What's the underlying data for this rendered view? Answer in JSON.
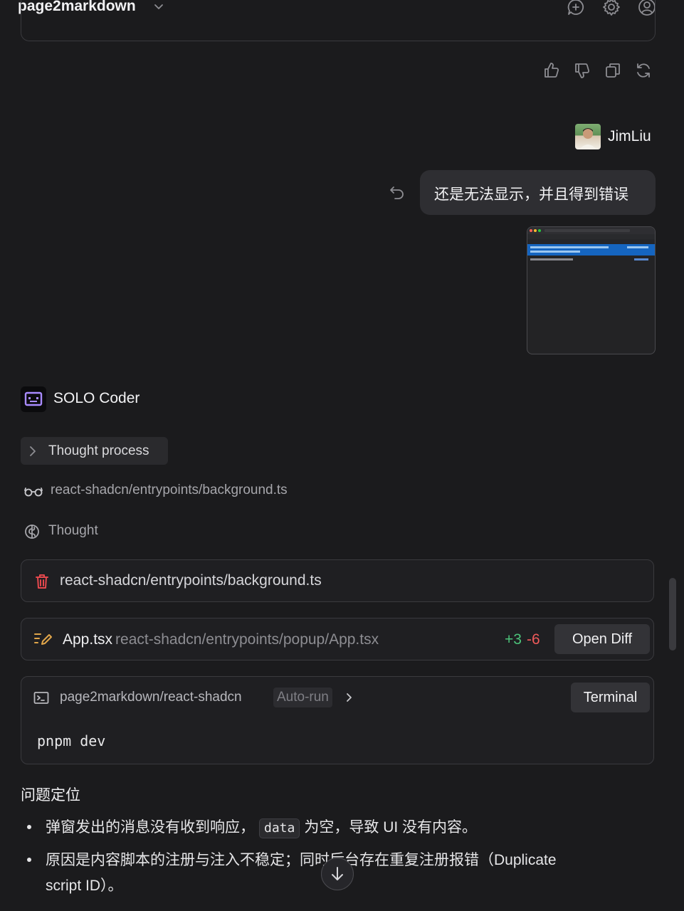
{
  "header": {
    "title": "page2markdown",
    "icons": [
      "new-chat-icon",
      "gear-icon",
      "account-icon"
    ]
  },
  "feedback": {
    "icons": [
      "thumbs-up-icon",
      "thumbs-down-icon",
      "copy-icon",
      "regenerate-icon"
    ]
  },
  "user_message": {
    "name": "JimLiu",
    "text": "还是无法显示，并且得到错误"
  },
  "assistant": {
    "name": "SOLO Coder",
    "thought_process_label": "Thought process",
    "read_file_path": "react-shadcn/entrypoints/background.ts",
    "thought_label": "Thought",
    "deleted_file": {
      "path": "react-shadcn/entrypoints/background.ts"
    },
    "diff": {
      "file": "App.tsx",
      "path": "react-shadcn/entrypoints/popup/App.tsx",
      "additions": "+3",
      "deletions": "-6",
      "button_label": "Open Diff"
    },
    "terminal": {
      "path": "page2markdown/react-shadcn",
      "badge": "Auto-run",
      "button_label": "Terminal",
      "command": "pnpm dev"
    },
    "section_heading": "问题定位",
    "bullets": [
      {
        "before": "弹窗发出的消息没有收到响应，",
        "code": "data",
        "after": "为空，导致 UI 没有内容。"
      },
      {
        "line1": "原因是内容脚本的注册与注入不稳定；同时后台存在重复注册报错（Duplicate",
        "line2": "script ID）。"
      }
    ]
  },
  "colors": {
    "background": "#1b1b1d",
    "addition": "#4cc37a",
    "deletion": "#ef5a5a",
    "bot_accent": "#a98bff",
    "trash": "#e5484d"
  }
}
